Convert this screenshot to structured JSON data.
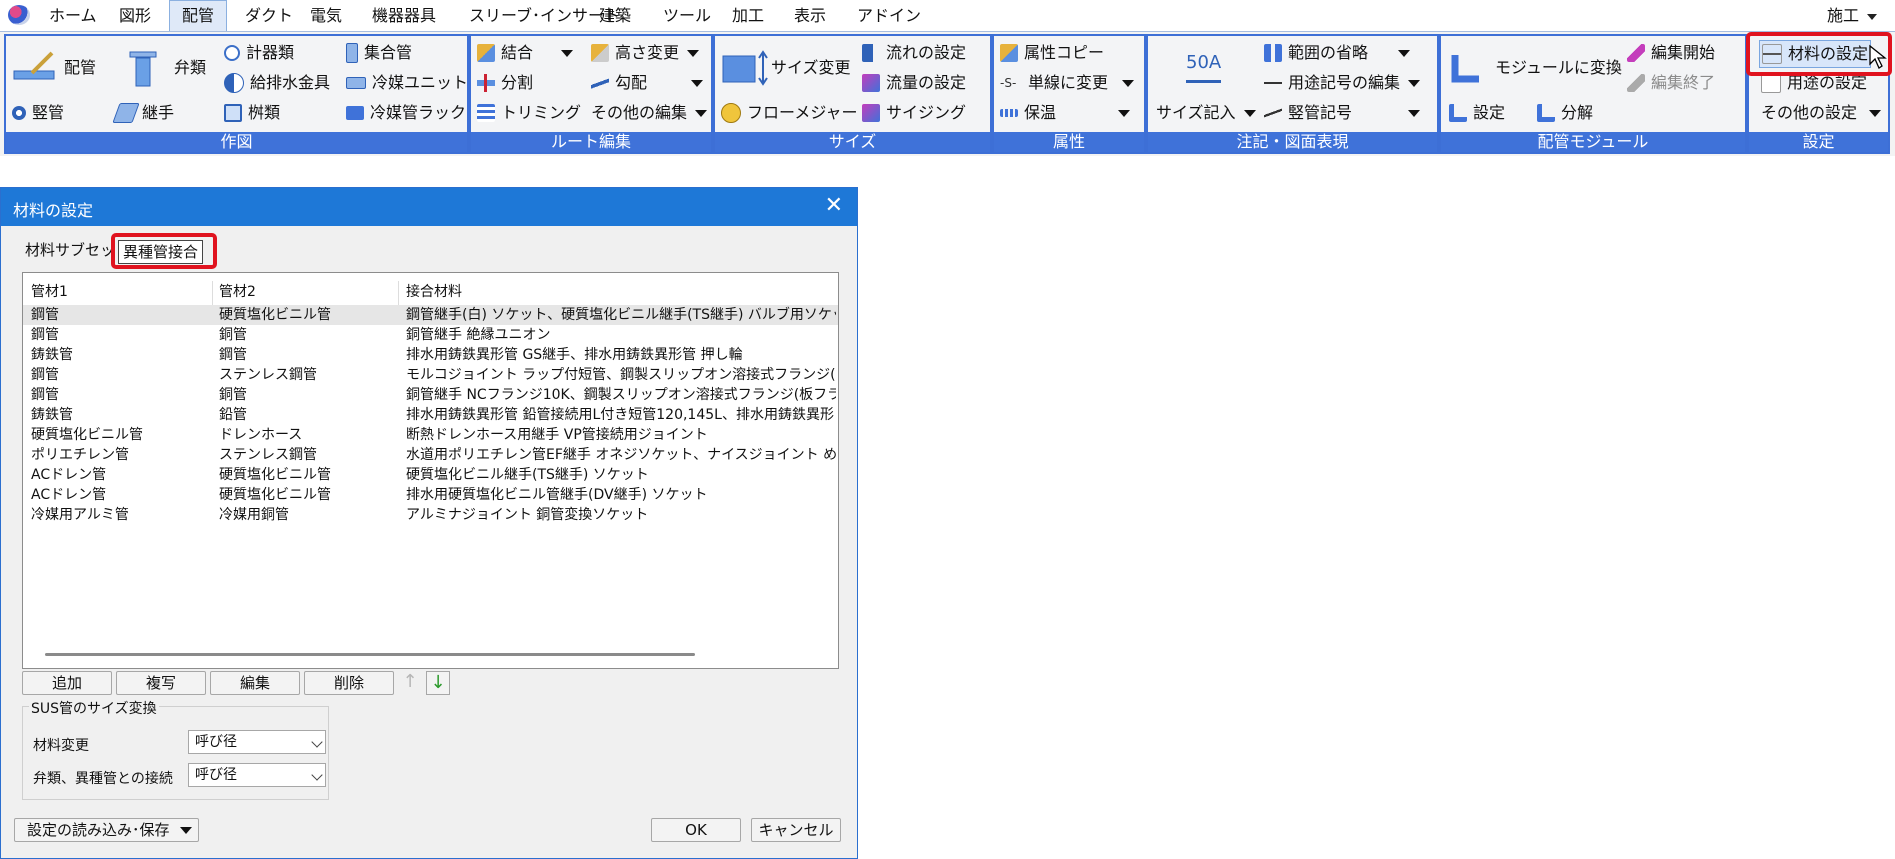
{
  "menu": {
    "items": [
      "ホーム",
      "図形",
      "配管",
      "ダクト",
      "電気",
      "機器器具",
      "スリーブ･インサート",
      "建築",
      "ツール",
      "加工",
      "表示",
      "アドイン"
    ],
    "active": "配管",
    "right": "施工"
  },
  "ribbon": {
    "sakuzu": {
      "label": "作図",
      "haikan": "配管",
      "benrui": "弁類",
      "keikirui": "計器類",
      "kyuhaisui": "給排水金具",
      "masu": "桝類",
      "shugokan": "集合管",
      "reibai_unit": "冷媒ユニット",
      "reibai_rack": "冷媒管ラック",
      "tatekan": "竪管",
      "tsugite": "継手"
    },
    "route": {
      "label": "ルート編集",
      "ketsugo": "結合",
      "bunkatsu": "分割",
      "trimming": "トリミング",
      "takasa": "高さ変更",
      "koubai": "勾配",
      "sonota": "その他の編集"
    },
    "size": {
      "label": "サイズ",
      "size_henko": "サイズ変更",
      "nagare": "流れの設定",
      "ryuryo": "流量の設定",
      "flow_measure": "フローメジャー",
      "sizing": "サイジング"
    },
    "zokusei": {
      "label": "属性",
      "copy": "属性コピー",
      "tansen": "単線に変更",
      "hoon": "保温"
    },
    "chuki": {
      "label": "注記・図面表現",
      "badge": "50A",
      "size_kinyu": "サイズ記入",
      "hani": "範囲の省略",
      "yoto_kigo": "用途記号の編集",
      "tatekan_kigo": "竪管記号"
    },
    "module": {
      "label": "配管モジュール",
      "convert": "モジュールに変換",
      "edit_start": "編集開始",
      "edit_end": "編集終了",
      "settei": "設定",
      "bunkai": "分解"
    },
    "settei": {
      "label": "設定",
      "zairyo": "材料の設定",
      "yoto": "用途の設定",
      "sonota": "その他の設定"
    }
  },
  "dialog": {
    "title": "材料の設定",
    "tabs": [
      "材料サブセット",
      "異種管接合"
    ],
    "active_tab": "異種管接合",
    "columns": [
      "管材1",
      "管材2",
      "接合材料"
    ],
    "rows": [
      [
        "鋼管",
        "硬質塩化ビニル管",
        "鋼管継手(白) ソケット、硬質塩化ビニル継手(TS継手) バルブ用ソケット"
      ],
      [
        "鋼管",
        "銅管",
        "銅管継手 絶縁ユニオン"
      ],
      [
        "鋳鉄管",
        "鋼管",
        "排水用鋳鉄異形管 GS継手、排水用鋳鉄異形管 押し輪"
      ],
      [
        "鋼管",
        "ステンレス鋼管",
        "モルコジョイント ラップ付短管、鋼製スリップオン溶接式フランジ(板フランジ)"
      ],
      [
        "鋼管",
        "銅管",
        "銅管継手 NCフランジ10K、鋼製スリップオン溶接式フランジ(板フランジ) JI"
      ],
      [
        "鋳鉄管",
        "鉛管",
        "排水用鋳鉄異形管 鉛管接続用L付き短管120,145L、排水用鋳鉄異形"
      ],
      [
        "硬質塩化ビニル管",
        "ドレンホース",
        "断熱ドレンホース用継手 VP管接続用ジョイント"
      ],
      [
        "ポリエチレン管",
        "ステンレス鋼管",
        "水道用ポリエチレン管EF継手 オネジソケット、ナイスジョイント めすアダプタ"
      ],
      [
        "ACドレン管",
        "硬質塩化ビニル管",
        "硬質塩化ビニル継手(TS継手) ソケット"
      ],
      [
        "ACドレン管",
        "硬質塩化ビニル管",
        "排水用硬質塩化ビニル管継手(DV継手) ソケット"
      ],
      [
        "冷媒用アルミ管",
        "冷媒用銅管",
        "アルミナジョイント 銅管変換ソケット"
      ]
    ],
    "buttons": {
      "add": "追加",
      "copy": "複写",
      "edit": "編集",
      "delete": "削除"
    },
    "sus": {
      "legend": "SUS管のサイズ変換",
      "material_change_label": "材料変更",
      "material_change_value": "呼び径",
      "valve_label": "弁類、異種管との接続",
      "valve_value": "呼び径"
    },
    "load_save": "設定の読み込み･保存",
    "ok": "OK",
    "cancel": "キャンセル"
  }
}
